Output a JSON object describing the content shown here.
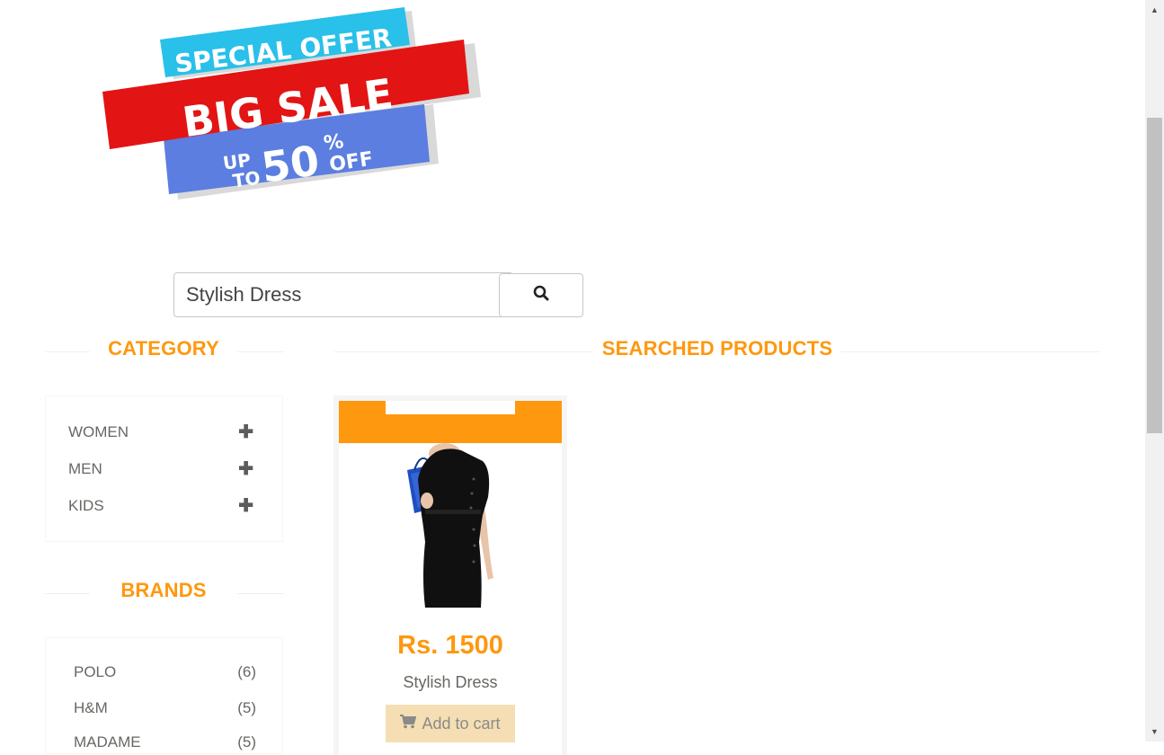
{
  "banner": {
    "line1": "SPECIAL OFFER",
    "line2": "BIG SALE",
    "up": "UP",
    "to": "TO",
    "percent": "50",
    "percent_sign": "%",
    "off": "OFF"
  },
  "search": {
    "value": "Stylish Dress",
    "button_icon": "search-icon"
  },
  "sidebar": {
    "category_title": "CATEGORY",
    "categories": [
      {
        "label": "WOMEN",
        "icon": "plus-icon"
      },
      {
        "label": "MEN",
        "icon": "plus-icon"
      },
      {
        "label": "KIDS",
        "icon": "plus-icon"
      }
    ],
    "brands_title": "BRANDS",
    "brands": [
      {
        "label": "POLO",
        "count": "(6)"
      },
      {
        "label": "H&M",
        "count": "(5)"
      },
      {
        "label": "MADAME",
        "count": "(5)"
      }
    ]
  },
  "main": {
    "title": "SEARCHED PRODUCTS",
    "products": [
      {
        "price": "Rs. 1500",
        "name": "Stylish Dress",
        "cart_label": "Add to cart",
        "cart_icon": "shopping-cart-icon"
      }
    ]
  },
  "colors": {
    "accent": "#fe980f",
    "text": "#696763",
    "cart_button_bg": "#f5deb3"
  }
}
